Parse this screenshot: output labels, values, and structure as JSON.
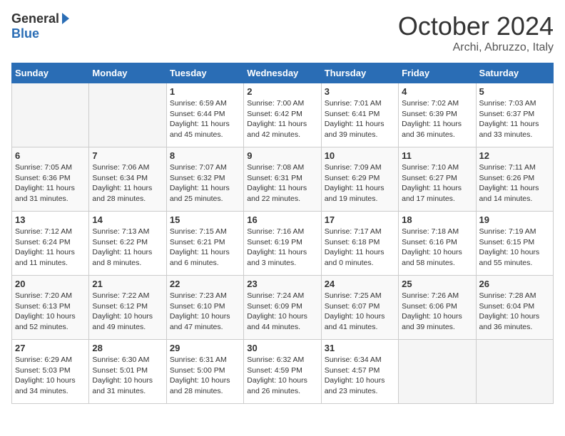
{
  "header": {
    "logo_general": "General",
    "logo_blue": "Blue",
    "month": "October 2024",
    "location": "Archi, Abruzzo, Italy"
  },
  "weekdays": [
    "Sunday",
    "Monday",
    "Tuesday",
    "Wednesday",
    "Thursday",
    "Friday",
    "Saturday"
  ],
  "weeks": [
    [
      {
        "day": "",
        "info": ""
      },
      {
        "day": "",
        "info": ""
      },
      {
        "day": "1",
        "info": "Sunrise: 6:59 AM\nSunset: 6:44 PM\nDaylight: 11 hours and 45 minutes."
      },
      {
        "day": "2",
        "info": "Sunrise: 7:00 AM\nSunset: 6:42 PM\nDaylight: 11 hours and 42 minutes."
      },
      {
        "day": "3",
        "info": "Sunrise: 7:01 AM\nSunset: 6:41 PM\nDaylight: 11 hours and 39 minutes."
      },
      {
        "day": "4",
        "info": "Sunrise: 7:02 AM\nSunset: 6:39 PM\nDaylight: 11 hours and 36 minutes."
      },
      {
        "day": "5",
        "info": "Sunrise: 7:03 AM\nSunset: 6:37 PM\nDaylight: 11 hours and 33 minutes."
      }
    ],
    [
      {
        "day": "6",
        "info": "Sunrise: 7:05 AM\nSunset: 6:36 PM\nDaylight: 11 hours and 31 minutes."
      },
      {
        "day": "7",
        "info": "Sunrise: 7:06 AM\nSunset: 6:34 PM\nDaylight: 11 hours and 28 minutes."
      },
      {
        "day": "8",
        "info": "Sunrise: 7:07 AM\nSunset: 6:32 PM\nDaylight: 11 hours and 25 minutes."
      },
      {
        "day": "9",
        "info": "Sunrise: 7:08 AM\nSunset: 6:31 PM\nDaylight: 11 hours and 22 minutes."
      },
      {
        "day": "10",
        "info": "Sunrise: 7:09 AM\nSunset: 6:29 PM\nDaylight: 11 hours and 19 minutes."
      },
      {
        "day": "11",
        "info": "Sunrise: 7:10 AM\nSunset: 6:27 PM\nDaylight: 11 hours and 17 minutes."
      },
      {
        "day": "12",
        "info": "Sunrise: 7:11 AM\nSunset: 6:26 PM\nDaylight: 11 hours and 14 minutes."
      }
    ],
    [
      {
        "day": "13",
        "info": "Sunrise: 7:12 AM\nSunset: 6:24 PM\nDaylight: 11 hours and 11 minutes."
      },
      {
        "day": "14",
        "info": "Sunrise: 7:13 AM\nSunset: 6:22 PM\nDaylight: 11 hours and 8 minutes."
      },
      {
        "day": "15",
        "info": "Sunrise: 7:15 AM\nSunset: 6:21 PM\nDaylight: 11 hours and 6 minutes."
      },
      {
        "day": "16",
        "info": "Sunrise: 7:16 AM\nSunset: 6:19 PM\nDaylight: 11 hours and 3 minutes."
      },
      {
        "day": "17",
        "info": "Sunrise: 7:17 AM\nSunset: 6:18 PM\nDaylight: 11 hours and 0 minutes."
      },
      {
        "day": "18",
        "info": "Sunrise: 7:18 AM\nSunset: 6:16 PM\nDaylight: 10 hours and 58 minutes."
      },
      {
        "day": "19",
        "info": "Sunrise: 7:19 AM\nSunset: 6:15 PM\nDaylight: 10 hours and 55 minutes."
      }
    ],
    [
      {
        "day": "20",
        "info": "Sunrise: 7:20 AM\nSunset: 6:13 PM\nDaylight: 10 hours and 52 minutes."
      },
      {
        "day": "21",
        "info": "Sunrise: 7:22 AM\nSunset: 6:12 PM\nDaylight: 10 hours and 49 minutes."
      },
      {
        "day": "22",
        "info": "Sunrise: 7:23 AM\nSunset: 6:10 PM\nDaylight: 10 hours and 47 minutes."
      },
      {
        "day": "23",
        "info": "Sunrise: 7:24 AM\nSunset: 6:09 PM\nDaylight: 10 hours and 44 minutes."
      },
      {
        "day": "24",
        "info": "Sunrise: 7:25 AM\nSunset: 6:07 PM\nDaylight: 10 hours and 41 minutes."
      },
      {
        "day": "25",
        "info": "Sunrise: 7:26 AM\nSunset: 6:06 PM\nDaylight: 10 hours and 39 minutes."
      },
      {
        "day": "26",
        "info": "Sunrise: 7:28 AM\nSunset: 6:04 PM\nDaylight: 10 hours and 36 minutes."
      }
    ],
    [
      {
        "day": "27",
        "info": "Sunrise: 6:29 AM\nSunset: 5:03 PM\nDaylight: 10 hours and 34 minutes."
      },
      {
        "day": "28",
        "info": "Sunrise: 6:30 AM\nSunset: 5:01 PM\nDaylight: 10 hours and 31 minutes."
      },
      {
        "day": "29",
        "info": "Sunrise: 6:31 AM\nSunset: 5:00 PM\nDaylight: 10 hours and 28 minutes."
      },
      {
        "day": "30",
        "info": "Sunrise: 6:32 AM\nSunset: 4:59 PM\nDaylight: 10 hours and 26 minutes."
      },
      {
        "day": "31",
        "info": "Sunrise: 6:34 AM\nSunset: 4:57 PM\nDaylight: 10 hours and 23 minutes."
      },
      {
        "day": "",
        "info": ""
      },
      {
        "day": "",
        "info": ""
      }
    ]
  ]
}
